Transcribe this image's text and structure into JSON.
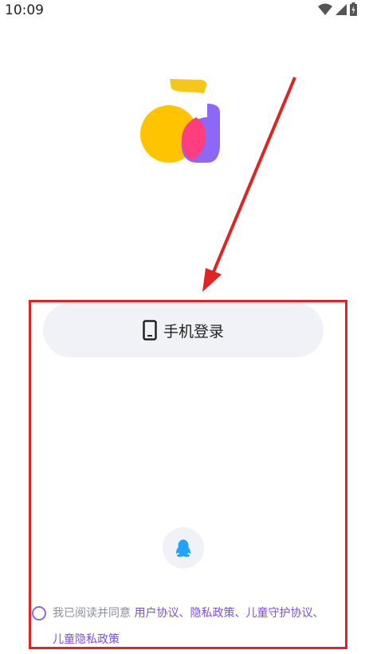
{
  "status_bar": {
    "time": "10:09",
    "icons": [
      "wifi-icon",
      "cellular-icon",
      "battery-icon"
    ]
  },
  "logo": {
    "colors": [
      "#ffc400",
      "#f6c61a",
      "#ff3e7f",
      "#8d68f7"
    ]
  },
  "login": {
    "phone_label": "手机登录"
  },
  "qq_login": {
    "icon": "qq-icon"
  },
  "agreement": {
    "prefix": "我已阅读并同意",
    "links": [
      "用户协议",
      "隐私政策",
      "儿童守护协议",
      "儿童隐私政策"
    ],
    "separator": "、"
  },
  "annotation": {
    "color": "#e02424"
  }
}
